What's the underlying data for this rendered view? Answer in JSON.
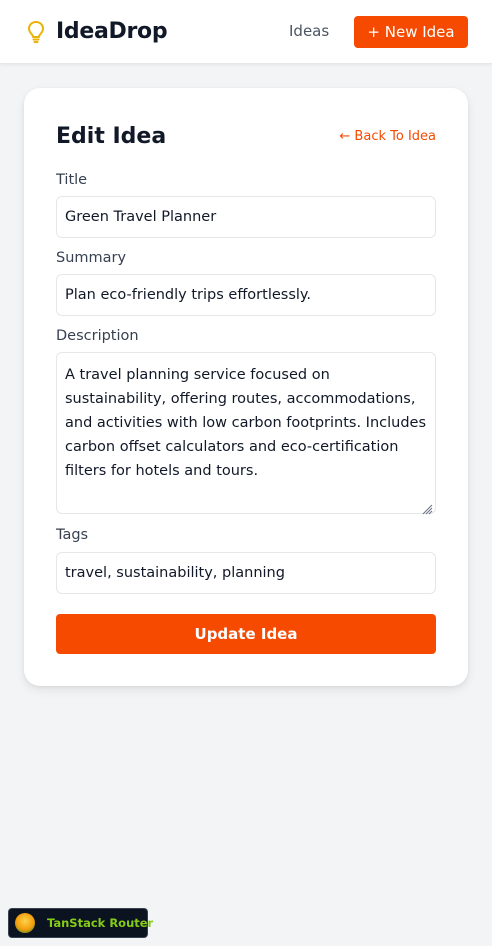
{
  "header": {
    "brand": "IdeaDrop",
    "nav_ideas": "Ideas",
    "new_idea_label": "+ New Idea",
    "brand_icon": "lightbulb-icon"
  },
  "form": {
    "title": "Edit Idea",
    "back_link": "← Back To Idea",
    "fields": {
      "title": {
        "label": "Title",
        "value": "Green Travel Planner"
      },
      "summary": {
        "label": "Summary",
        "value": "Plan eco-friendly trips effortlessly."
      },
      "description": {
        "label": "Description",
        "value": "A travel planning service focused on sustainability, offering routes, accommodations, and activities with low carbon footprints. Includes carbon offset calculators and eco-certification filters for hotels and tours."
      },
      "tags": {
        "label": "Tags",
        "value": "travel, sustainability, planning"
      }
    },
    "submit_label": "Update Idea"
  },
  "devtools": {
    "label": "TanStack Router"
  },
  "colors": {
    "accent": "#f54a00",
    "background": "#f3f4f6",
    "brand_icon": "#eab308"
  }
}
